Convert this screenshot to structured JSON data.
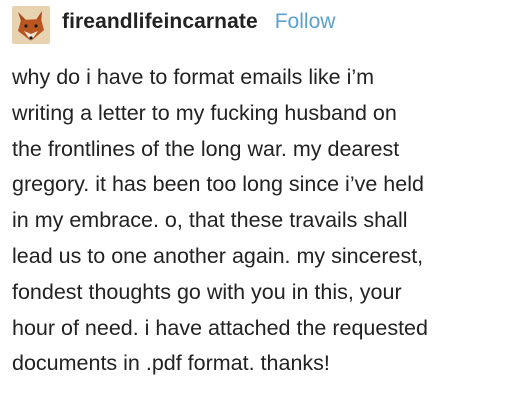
{
  "post": {
    "author": {
      "avatar_icon": "fox-avatar-icon",
      "username": "fireandlifeincarnate"
    },
    "follow_label": "Follow",
    "colors": {
      "follow": "#5aa1cf",
      "text": "#222222"
    },
    "body_lines": [
      "why do i have to format emails like i’m",
      "writing a letter to my fucking husband on",
      "the frontlines of the long war. my dearest",
      "gregory. it has been too long since i’ve held",
      "in my embrace. o, that these travails shall",
      "lead us to one another again. my sincerest,",
      "fondest thoughts go with you in this, your",
      "hour of need. i have attached the requested",
      "documents in .pdf format. thanks!"
    ]
  }
}
